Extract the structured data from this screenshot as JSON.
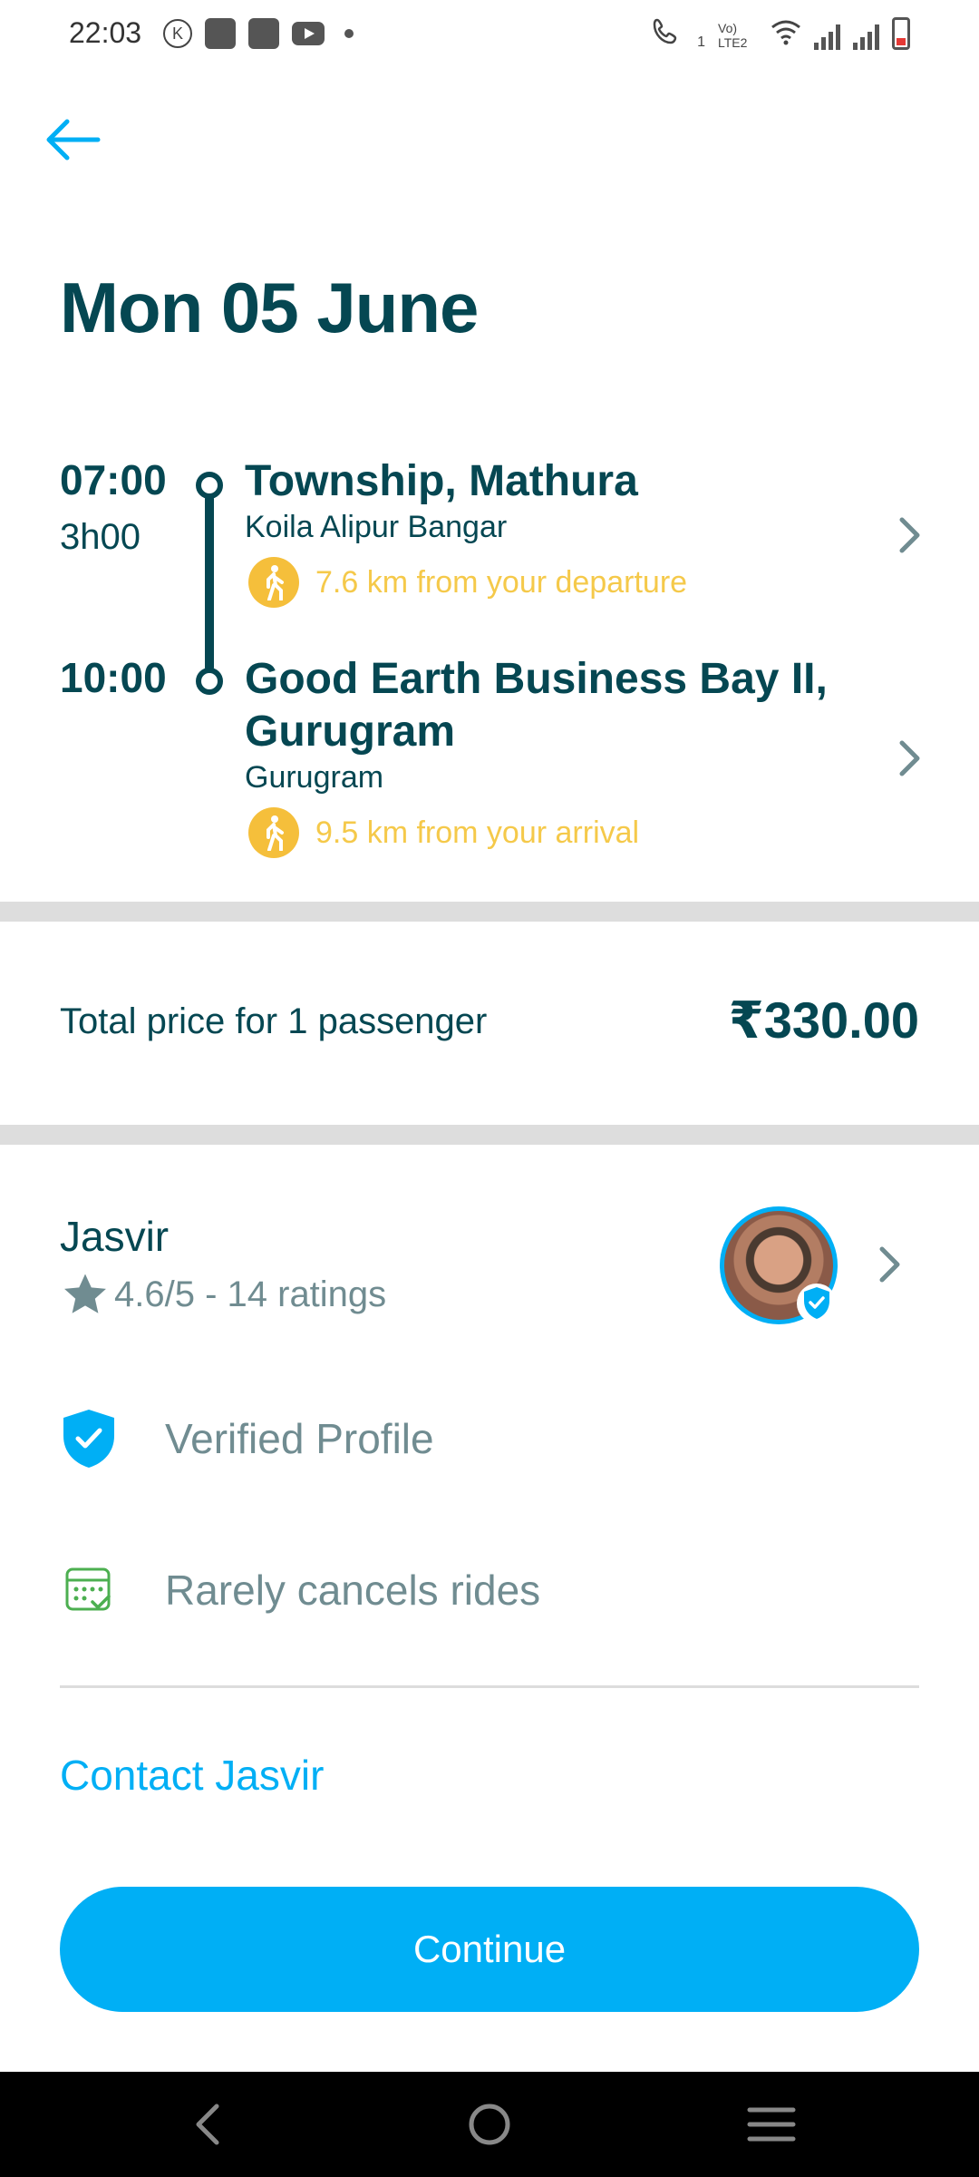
{
  "status_bar": {
    "time": "22:03",
    "left_icons": [
      "k-circle-icon",
      "shopping-bag-icon",
      "shopping-bag-icon",
      "youtube-icon",
      "dot-icon"
    ],
    "right_icons": [
      "volte-call-icon",
      "vol-lte2-icon",
      "wifi-icon",
      "signal-icon",
      "signal-icon",
      "battery-low-icon"
    ],
    "call_label": "1",
    "volte_label": "Vo) LTE2"
  },
  "header": {
    "back_icon": "arrow-left-icon"
  },
  "trip": {
    "date": "Mon 05 June",
    "departure": {
      "time": "07:00",
      "duration": "3h00",
      "place": "Township, Mathura",
      "area": "Koila Alipur Bangar",
      "walk_distance": "7.6 km from your departure"
    },
    "arrival": {
      "time": "10:00",
      "place_line1": "Good Earth Business Bay II,",
      "place_line2": "Gurugram",
      "area": "Gurugram",
      "walk_distance": "9.5 km from your arrival"
    }
  },
  "price": {
    "label": "Total price for 1 passenger",
    "value": "₹330.00"
  },
  "driver": {
    "name": "Jasvir",
    "rating": "4.6/5 - 14 ratings",
    "features": [
      {
        "icon": "verified-shield-icon",
        "label": "Verified Profile"
      },
      {
        "icon": "calendar-check-icon",
        "label": "Rarely cancels rides"
      }
    ],
    "contact_label": "Contact Jasvir"
  },
  "actions": {
    "continue_label": "Continue"
  },
  "colors": {
    "primary": "#00aff5",
    "text_dark": "#054752",
    "text_muted": "#708c91",
    "walk_yellow": "#f5bf3b",
    "feature_green": "#4caf50"
  }
}
